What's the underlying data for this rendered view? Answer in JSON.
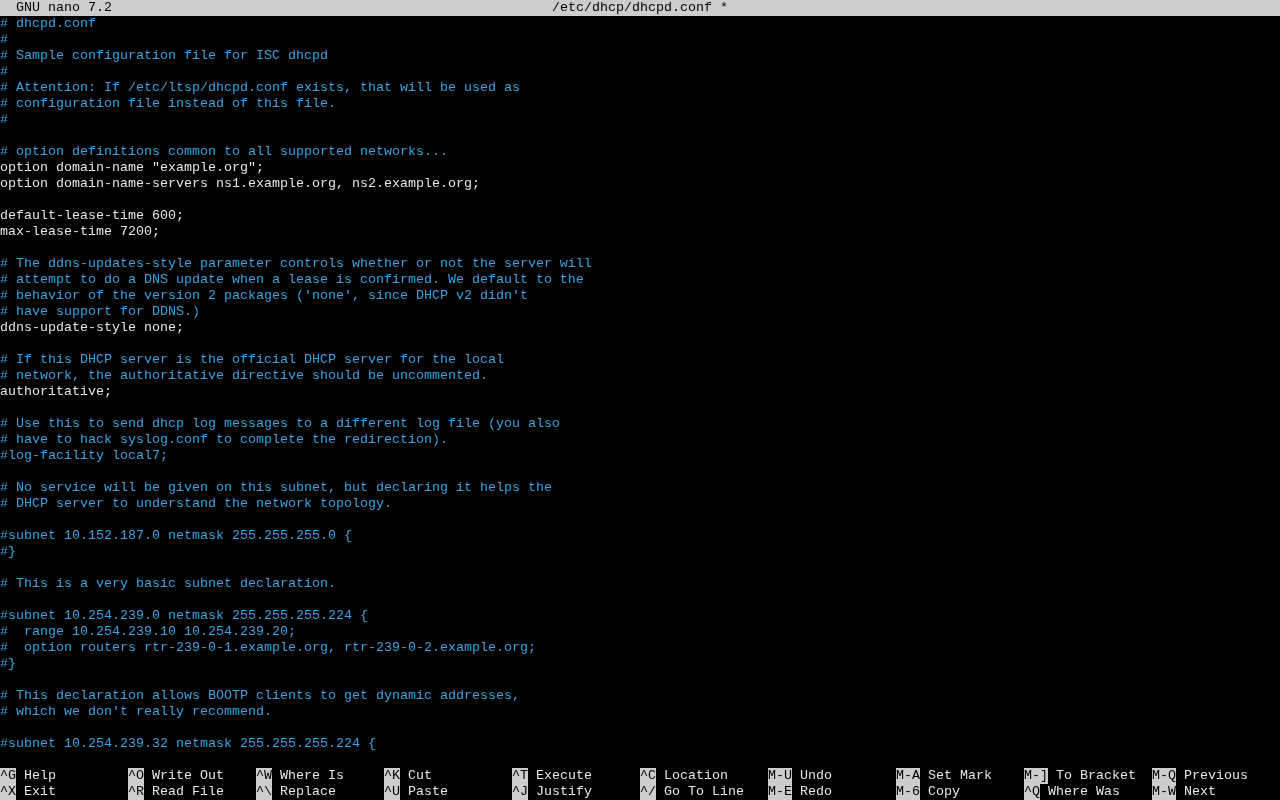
{
  "title_bar": {
    "app": "GNU nano 7.2",
    "filename": "/etc/dhcp/dhcpd.conf",
    "modified_mark": "*"
  },
  "lines": [
    {
      "kind": "comment",
      "text": "# dhcpd.conf"
    },
    {
      "kind": "comment",
      "text": "#"
    },
    {
      "kind": "comment",
      "text": "# Sample configuration file for ISC dhcpd"
    },
    {
      "kind": "comment",
      "text": "#"
    },
    {
      "kind": "comment",
      "text": "# Attention: If /etc/ltsp/dhcpd.conf exists, that will be used as"
    },
    {
      "kind": "comment",
      "text": "# configuration file instead of this file."
    },
    {
      "kind": "comment",
      "text": "#"
    },
    {
      "kind": "blank"
    },
    {
      "kind": "comment",
      "text": "# option definitions common to all supported networks..."
    },
    {
      "kind": "code",
      "text": "option domain-name \"example.org\";"
    },
    {
      "kind": "code",
      "text": "option domain-name-servers ns1.example.org, ns2.example.org;"
    },
    {
      "kind": "blank"
    },
    {
      "kind": "code",
      "text": "default-lease-time 600;"
    },
    {
      "kind": "code",
      "text": "max-lease-time 7200;"
    },
    {
      "kind": "blank"
    },
    {
      "kind": "comment",
      "text": "# The ddns-updates-style parameter controls whether or not the server will"
    },
    {
      "kind": "comment",
      "text": "# attempt to do a DNS update when a lease is confirmed. We default to the"
    },
    {
      "kind": "comment",
      "text": "# behavior of the version 2 packages ('none', since DHCP v2 didn't"
    },
    {
      "kind": "comment",
      "text": "# have support for DDNS.)"
    },
    {
      "kind": "code",
      "text": "ddns-update-style none;"
    },
    {
      "kind": "blank"
    },
    {
      "kind": "comment",
      "text": "# If this DHCP server is the official DHCP server for the local"
    },
    {
      "kind": "comment",
      "text": "# network, the authoritative directive should be uncommented."
    },
    {
      "kind": "code",
      "text": "authoritative;"
    },
    {
      "kind": "blank"
    },
    {
      "kind": "comment",
      "text": "# Use this to send dhcp log messages to a different log file (you also"
    },
    {
      "kind": "comment",
      "text": "# have to hack syslog.conf to complete the redirection)."
    },
    {
      "kind": "comment",
      "text": "#log-facility local7;"
    },
    {
      "kind": "blank"
    },
    {
      "kind": "comment",
      "text": "# No service will be given on this subnet, but declaring it helps the"
    },
    {
      "kind": "comment",
      "text": "# DHCP server to understand the network topology."
    },
    {
      "kind": "blank"
    },
    {
      "kind": "comment",
      "text": "#subnet 10.152.187.0 netmask 255.255.255.0 {"
    },
    {
      "kind": "comment",
      "text": "#}"
    },
    {
      "kind": "blank"
    },
    {
      "kind": "comment",
      "text": "# This is a very basic subnet declaration."
    },
    {
      "kind": "blank"
    },
    {
      "kind": "comment",
      "text": "#subnet 10.254.239.0 netmask 255.255.255.224 {"
    },
    {
      "kind": "comment",
      "text": "#  range 10.254.239.10 10.254.239.20;"
    },
    {
      "kind": "comment",
      "text": "#  option routers rtr-239-0-1.example.org, rtr-239-0-2.example.org;"
    },
    {
      "kind": "comment",
      "text": "#}"
    },
    {
      "kind": "blank"
    },
    {
      "kind": "comment",
      "text": "# This declaration allows BOOTP clients to get dynamic addresses,"
    },
    {
      "kind": "comment",
      "text": "# which we don't really recommend."
    },
    {
      "kind": "blank"
    },
    {
      "kind": "comment",
      "text": "#subnet 10.254.239.32 netmask 255.255.255.224 {"
    }
  ],
  "shortcut_rows": [
    [
      {
        "key": "^G",
        "label": "Help"
      },
      {
        "key": "^O",
        "label": "Write Out"
      },
      {
        "key": "^W",
        "label": "Where Is"
      },
      {
        "key": "^K",
        "label": "Cut"
      },
      {
        "key": "^T",
        "label": "Execute"
      },
      {
        "key": "^C",
        "label": "Location"
      },
      {
        "key": "M-U",
        "label": "Undo"
      },
      {
        "key": "M-A",
        "label": "Set Mark"
      },
      {
        "key": "M-]",
        "label": "To Bracket"
      },
      {
        "key": "M-Q",
        "label": "Previous"
      }
    ],
    [
      {
        "key": "^X",
        "label": "Exit"
      },
      {
        "key": "^R",
        "label": "Read File"
      },
      {
        "key": "^\\",
        "label": "Replace"
      },
      {
        "key": "^U",
        "label": "Paste"
      },
      {
        "key": "^J",
        "label": "Justify"
      },
      {
        "key": "^/",
        "label": "Go To Line"
      },
      {
        "key": "M-E",
        "label": "Redo"
      },
      {
        "key": "M-6",
        "label": "Copy"
      },
      {
        "key": "^Q",
        "label": "Where Was"
      },
      {
        "key": "M-W",
        "label": "Next"
      }
    ]
  ]
}
